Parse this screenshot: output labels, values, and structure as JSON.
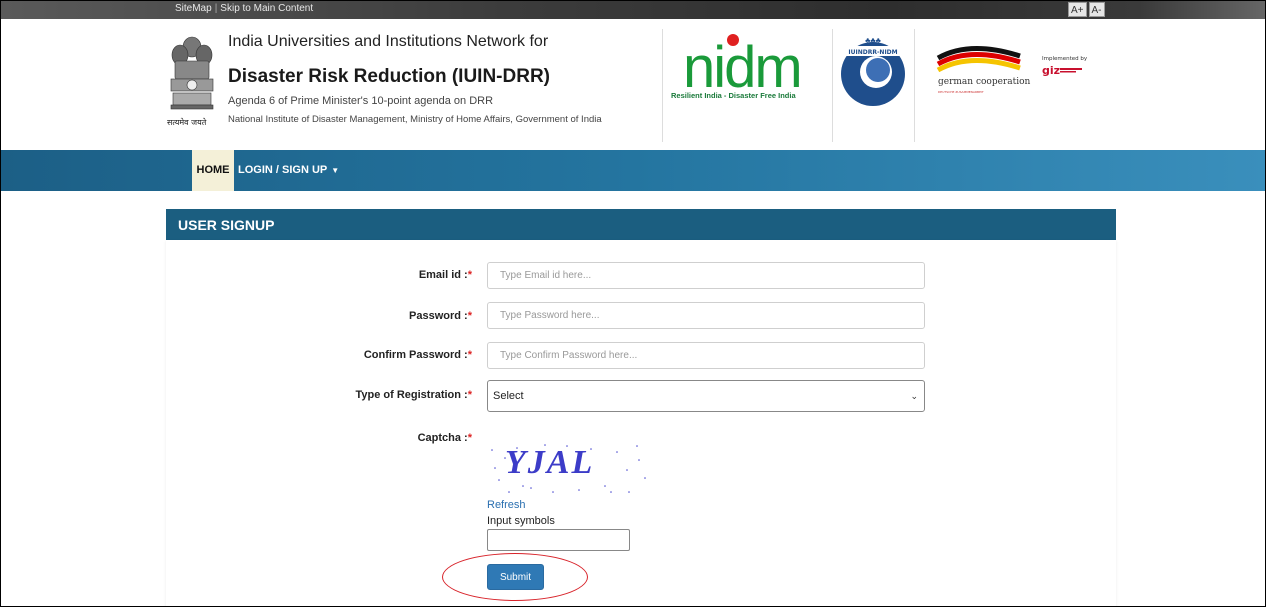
{
  "topbar": {
    "sitemap": "SiteMap",
    "skip": "Skip to Main Content",
    "font_increase": "A+",
    "font_decrease": "A-"
  },
  "header": {
    "line1": "India Universities and Institutions Network for",
    "line2": "Disaster Risk Reduction (IUIN-DRR)",
    "line3": "Agenda 6 of Prime Minister's 10-point agenda on DRR",
    "line4": "National Institute of Disaster Management, Ministry of Home Affairs, Government of India",
    "emblem_motto": "सत्यमेव जयते",
    "nidm_logo": "nidm",
    "nidm_tagline": "Resilient India - Disaster Free India",
    "iuin_logo": "IUINDRR-NIDM",
    "german_logo": "german cooperation",
    "german_sub": "DEUTSCHE ZUSAMMENARBEIT",
    "implemented_by": "Implemented by",
    "giz": "giz"
  },
  "nav": {
    "home": "HOME",
    "login": "LOGIN / SIGN UP"
  },
  "form": {
    "heading": "USER SIGNUP",
    "email_label": "Email id :",
    "email_placeholder": "Type Email id here...",
    "password_label": "Password :",
    "password_placeholder": "Type Password here...",
    "confirm_label": "Confirm Password :",
    "confirm_placeholder": "Type Confirm Password here...",
    "reg_type_label": "Type of Registration :",
    "reg_type_value": "Select",
    "captcha_label": "Captcha :",
    "captcha_text": "YJAL",
    "refresh": "Refresh",
    "input_symbols": "Input symbols",
    "submit": "Submit",
    "required_mark": "*"
  },
  "colors": {
    "nav_blue": "#2475a0",
    "panel_head": "#1b5e80",
    "submit_blue": "#2f79b5",
    "highlight_red": "#d8232a",
    "nidm_green": "#1a9a3a"
  }
}
